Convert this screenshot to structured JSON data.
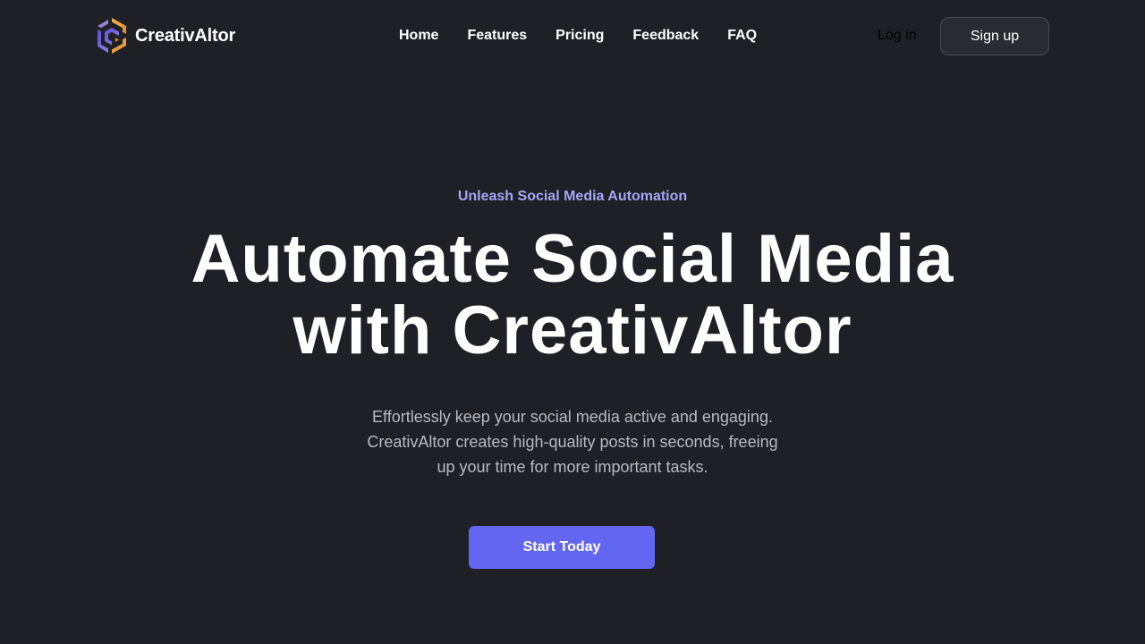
{
  "header": {
    "brand": {
      "name": "CreativAltor",
      "icon": "hexagon-logo-icon"
    },
    "nav": [
      {
        "label": "Home"
      },
      {
        "label": "Features"
      },
      {
        "label": "Pricing"
      },
      {
        "label": "Feedback"
      },
      {
        "label": "FAQ"
      }
    ],
    "login_label": "Log in",
    "signup_label": "Sign up"
  },
  "hero": {
    "eyebrow": "Unleash Social Media Automation",
    "headline_line1": "Automate Social Media",
    "headline_line2": "with CreativAltor",
    "subtitle_line1": "Effortlessly keep your social media active and engaging.",
    "subtitle_line2": "CreativAltor creates high-quality posts in seconds, freeing",
    "subtitle_line3": "up your time for more important tasks.",
    "cta_label": "Start Today"
  },
  "colors": {
    "background": "#1f2025",
    "accent": "#6366f1",
    "eyebrow": "#a5a6f6",
    "logo_purple": "#6b5fd3",
    "logo_orange": "#f0a63a"
  }
}
